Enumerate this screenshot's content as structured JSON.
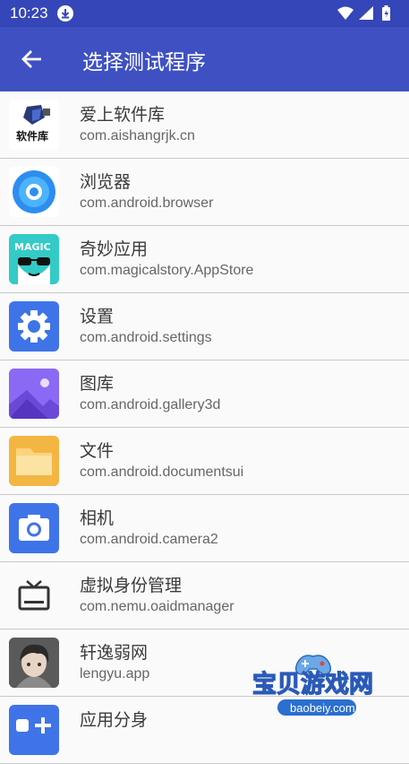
{
  "status": {
    "time": "10:23"
  },
  "appbar": {
    "title": "选择测试程序"
  },
  "apps": [
    {
      "name": "爱上软件库",
      "package": "com.aishangrjk.cn",
      "icon": "aishang-logo-icon",
      "logo_text": "软件库"
    },
    {
      "name": "浏览器",
      "package": "com.android.browser",
      "icon": "browser-icon"
    },
    {
      "name": "奇妙应用",
      "package": "com.magicalstory.AppStore",
      "icon": "magic-icon",
      "logo_text": "MAGIC"
    },
    {
      "name": "设置",
      "package": "com.android.settings",
      "icon": "settings-gear-icon"
    },
    {
      "name": "图库",
      "package": "com.android.gallery3d",
      "icon": "gallery-icon"
    },
    {
      "name": "文件",
      "package": "com.android.documentsui",
      "icon": "folder-icon"
    },
    {
      "name": "相机",
      "package": "com.android.camera2",
      "icon": "camera-icon"
    },
    {
      "name": "虚拟身份管理",
      "package": "com.nemu.oaidmanager",
      "icon": "tv-icon"
    },
    {
      "name": "轩逸弱网",
      "package": "lengyu.app",
      "icon": "anime-avatar-icon"
    },
    {
      "name": "应用分身",
      "package": "",
      "icon": "app-clone-icon"
    }
  ],
  "watermark": {
    "text": "宝贝游戏网",
    "url": "baobeiy.com"
  },
  "colors": {
    "status_bar": "#3546b8",
    "app_bar": "#3f51c2",
    "divider": "#c8c8c8"
  }
}
